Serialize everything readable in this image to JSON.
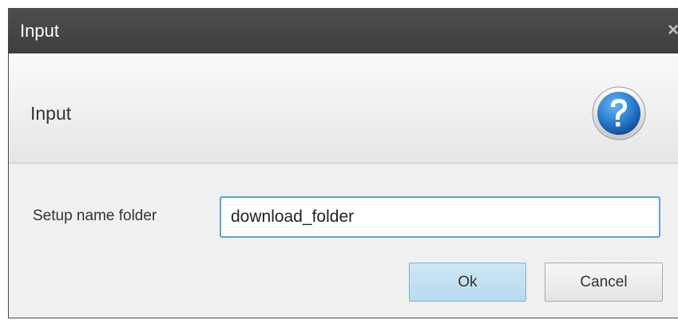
{
  "window": {
    "title": "Input",
    "close_glyph": "×"
  },
  "header": {
    "heading": "Input",
    "icon": "question-icon"
  },
  "form": {
    "label": "Setup name folder",
    "value": "download_folder"
  },
  "buttons": {
    "ok_label": "Ok",
    "cancel_label": "Cancel"
  },
  "colors": {
    "titlebar": "#444444",
    "accent_border": "#5aa4d8",
    "ok_button": "#c2e1f2",
    "icon_blue": "#1f6fc4"
  }
}
